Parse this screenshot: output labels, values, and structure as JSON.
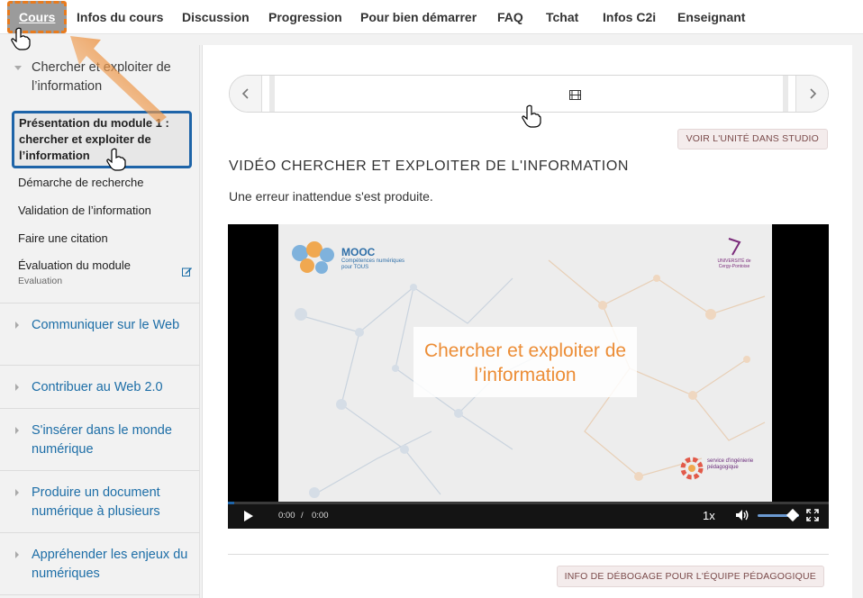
{
  "topnav": {
    "tabs": [
      {
        "label": "Cours",
        "active": true
      },
      {
        "label": "Infos du cours"
      },
      {
        "label": "Discussion"
      },
      {
        "label": "Progression"
      },
      {
        "label": "Pour bien démarrer"
      },
      {
        "label": "FAQ"
      },
      {
        "label": "Tchat"
      },
      {
        "label": "Infos C2i"
      },
      {
        "label": "Enseignant"
      }
    ]
  },
  "sidebar": {
    "open_chapter": "Chercher et exploiter de l’information",
    "subsections": [
      {
        "label": "Présentation du module 1 : chercher et exploiter de l’information",
        "current": true
      },
      {
        "label": "Démarche de recherche"
      },
      {
        "label": "Validation de l’information"
      },
      {
        "label": "Faire une citation"
      },
      {
        "label": "Évaluation du module",
        "sublabel": "Evaluation"
      }
    ],
    "chapters": [
      "Communiquer sur le Web",
      "Contribuer au Web 2.0",
      "S'insérer dans le monde numérique",
      "Produire un document numérique à plusieurs",
      "Appréhender les enjeux du numériques"
    ]
  },
  "main": {
    "studio_button": "VOIR L'UNITÉ DANS STUDIO",
    "unit_title": "VIDÉO CHERCHER ET EXPLOITER DE L'INFORMATION",
    "error_text": "Une erreur inattendue s'est produite.",
    "debug_button": "INFO DE DÉBOGAGE POUR L'ÉQUIPE PÉDAGOGIQUE"
  },
  "video": {
    "slide_title": "Chercher et exploiter de l’information",
    "mooc_title": "MOOC",
    "mooc_subtitle": "Compétences numériques pour TOUS",
    "univ_label": "UNIVERSITÉ de Cergy-Pontoise",
    "sip_label": "service d'ingénierie pédagogique",
    "time_current": "0:00",
    "time_separator": "/",
    "time_total": "0:00",
    "speed": "1x",
    "progress": 0.01,
    "volume": 0.85
  },
  "colors": {
    "link_blue": "#1d6ea7",
    "highlight_border": "#1e64a8",
    "arrow_orange": "#e87b1e",
    "slide_accent": "#ec8d36"
  },
  "icons": [
    "chevron-left-icon",
    "chevron-right-icon",
    "film-icon",
    "edit-icon",
    "play-icon",
    "volume-icon",
    "fullscreen-icon",
    "hand-cursor-icon"
  ]
}
